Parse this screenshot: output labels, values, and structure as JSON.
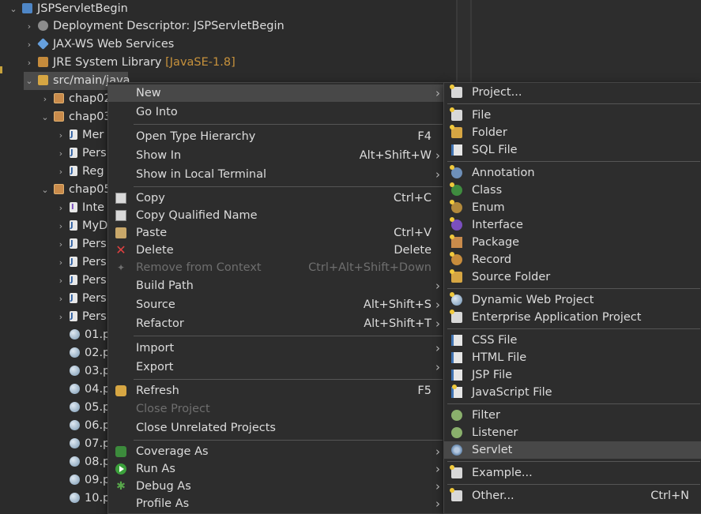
{
  "tree": {
    "project": "JSPServletBegin",
    "items": [
      {
        "label": "Deployment Descriptor: JSPServletBegin",
        "icon": "deployment-descriptor-icon"
      },
      {
        "label": "JAX-WS Web Services",
        "icon": "web-services-icon"
      },
      {
        "label": "JRE System Library",
        "tag": "[JavaSE-1.8]",
        "icon": "library-icon"
      },
      {
        "label": "src/main/java",
        "icon": "source-folder-icon"
      }
    ],
    "packages": [
      {
        "label": "chap02"
      },
      {
        "label": "chap03"
      },
      {
        "label": "chap05"
      }
    ],
    "chap03_files": [
      "Mer",
      "Pers",
      "Reg"
    ],
    "chap05_files": [
      "Inte",
      "MyD",
      "Pers",
      "Pers",
      "Pers",
      "Pers",
      "Pers"
    ],
    "web_files": [
      "01.p",
      "02.p",
      "03.p",
      "04.p",
      "05.p",
      "06.p",
      "07.p",
      "08.p",
      "09.p",
      "10.p"
    ]
  },
  "context_menu": {
    "items": [
      {
        "label": "New",
        "shortcut": "",
        "submenu": true
      },
      {
        "label": "Go Into",
        "shortcut": ""
      },
      {
        "label": "Open Type Hierarchy",
        "shortcut": "F4"
      },
      {
        "label": "Show In",
        "shortcut": "Alt+Shift+W",
        "submenu": true
      },
      {
        "label": "Show in Local Terminal",
        "shortcut": "",
        "submenu": true
      },
      {
        "label": "Copy",
        "shortcut": "Ctrl+C"
      },
      {
        "label": "Copy Qualified Name",
        "shortcut": ""
      },
      {
        "label": "Paste",
        "shortcut": "Ctrl+V"
      },
      {
        "label": "Delete",
        "shortcut": "Delete"
      },
      {
        "label": "Remove from Context",
        "shortcut": "Ctrl+Alt+Shift+Down",
        "disabled": true
      },
      {
        "label": "Build Path",
        "shortcut": "",
        "submenu": true
      },
      {
        "label": "Source",
        "shortcut": "Alt+Shift+S",
        "submenu": true
      },
      {
        "label": "Refactor",
        "shortcut": "Alt+Shift+T",
        "submenu": true
      },
      {
        "label": "Import",
        "shortcut": "",
        "submenu": true
      },
      {
        "label": "Export",
        "shortcut": "",
        "submenu": true
      },
      {
        "label": "Refresh",
        "shortcut": "F5"
      },
      {
        "label": "Close Project",
        "shortcut": "",
        "disabled": true
      },
      {
        "label": "Close Unrelated Projects",
        "shortcut": ""
      },
      {
        "label": "Coverage As",
        "shortcut": "",
        "submenu": true
      },
      {
        "label": "Run As",
        "shortcut": "",
        "submenu": true
      },
      {
        "label": "Debug As",
        "shortcut": "",
        "submenu": true
      },
      {
        "label": "Profile As",
        "shortcut": "",
        "submenu": true
      }
    ]
  },
  "new_submenu": {
    "items": [
      {
        "label": "Project..."
      },
      {
        "label": "File"
      },
      {
        "label": "Folder"
      },
      {
        "label": "SQL File"
      },
      {
        "label": "Annotation"
      },
      {
        "label": "Class"
      },
      {
        "label": "Enum"
      },
      {
        "label": "Interface"
      },
      {
        "label": "Package"
      },
      {
        "label": "Record"
      },
      {
        "label": "Source Folder"
      },
      {
        "label": "Dynamic Web Project"
      },
      {
        "label": "Enterprise Application Project"
      },
      {
        "label": "CSS File"
      },
      {
        "label": "HTML File"
      },
      {
        "label": "JSP File"
      },
      {
        "label": "JavaScript File"
      },
      {
        "label": "Filter"
      },
      {
        "label": "Listener"
      },
      {
        "label": "Servlet"
      },
      {
        "label": "Example..."
      },
      {
        "label": "Other...",
        "shortcut": "Ctrl+N"
      }
    ],
    "highlighted": "Servlet"
  },
  "colors": {
    "background": "#2b2b2b",
    "menu": "#2d2d2d",
    "highlight": "#484848",
    "text": "#dcdcdc",
    "disabled": "#6e6e6e",
    "jre_tag": "#c7923c"
  }
}
